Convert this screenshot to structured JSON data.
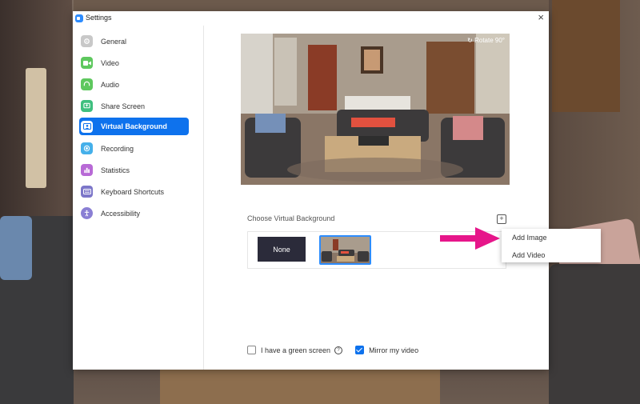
{
  "window": {
    "title": "Settings",
    "close_glyph": "×"
  },
  "sidebar": {
    "items": [
      {
        "label": "General",
        "icon": "gear-icon",
        "color": "#c8c8c8",
        "active": false
      },
      {
        "label": "Video",
        "icon": "video-camera-icon",
        "color": "#5ec85e",
        "active": false
      },
      {
        "label": "Audio",
        "icon": "headphones-icon",
        "color": "#5ec85e",
        "active": false
      },
      {
        "label": "Share Screen",
        "icon": "share-screen-icon",
        "color": "#3fbf7f",
        "active": false
      },
      {
        "label": "Virtual Background",
        "icon": "person-card-icon",
        "color": "#0e72ed",
        "active": true
      },
      {
        "label": "Recording",
        "icon": "record-icon",
        "color": "#45b0ea",
        "active": false
      },
      {
        "label": "Statistics",
        "icon": "bar-chart-icon",
        "color": "#b86ad6",
        "active": false
      },
      {
        "label": "Keyboard Shortcuts",
        "icon": "keyboard-icon",
        "color": "#7c76c9",
        "active": false
      },
      {
        "label": "Accessibility",
        "icon": "accessibility-icon",
        "color": "#8a7fd4",
        "active": false
      }
    ]
  },
  "preview": {
    "rotate_label": "Rotate 90°"
  },
  "backgrounds": {
    "label": "Choose Virtual Background",
    "add_glyph": "+",
    "none_label": "None",
    "selected": "living-room"
  },
  "add_menu": {
    "items": [
      "Add Image",
      "Add Video"
    ]
  },
  "footer": {
    "green_screen_label": "I have a green screen",
    "green_screen_checked": false,
    "mirror_label": "Mirror my video",
    "mirror_checked": true,
    "help_glyph": "?"
  },
  "colors": {
    "accent": "#0e72ed",
    "arrow": "#e6168a"
  }
}
